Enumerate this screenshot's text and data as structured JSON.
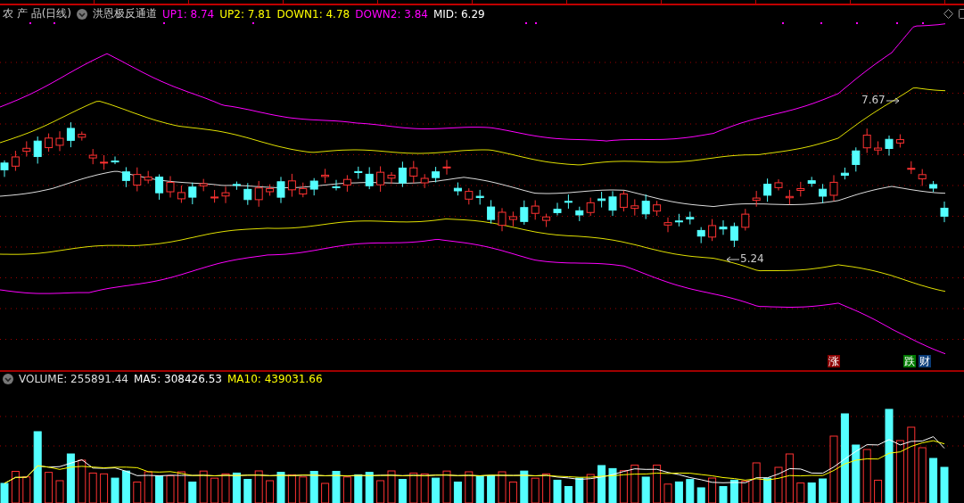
{
  "chart_header": {
    "symbol": "农 产 品(日线)",
    "indicator_name": "洪恩极反通道",
    "indicators": [
      {
        "label": "UP1: 8.74",
        "color": "#ff00ff"
      },
      {
        "label": "UP2: 7.81",
        "color": "#ffff00"
      },
      {
        "label": "DOWN1: 4.78",
        "color": "#ffff00"
      },
      {
        "label": "DOWN2: 3.84",
        "color": "#ff00ff"
      },
      {
        "label": "MID: 6.29",
        "color": "#ffffff"
      }
    ]
  },
  "price_labels": [
    {
      "text": "7.67",
      "kind": "high"
    },
    {
      "text": "5.24",
      "kind": "low"
    }
  ],
  "badges": [
    {
      "text": "涨",
      "color": "#8b0000"
    },
    {
      "text": "跌",
      "color": "#007a00"
    },
    {
      "text": "财",
      "color": "#0a3c78"
    }
  ],
  "volume_header": {
    "title": "VOLUME: 255891.44",
    "averages": [
      {
        "label": "MA5: 308426.53",
        "color": "#ffffff"
      },
      {
        "label": "MA10: 439031.66",
        "color": "#ffff00"
      }
    ]
  }
}
